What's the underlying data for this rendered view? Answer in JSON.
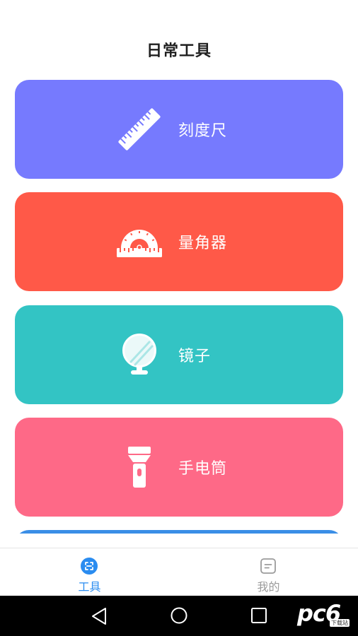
{
  "header": {
    "title": "日常工具"
  },
  "tools": [
    {
      "label": "刻度尺",
      "color": "#767AFE",
      "icon": "ruler-icon"
    },
    {
      "label": "量角器",
      "color": "#FF5948",
      "icon": "protractor-icon"
    },
    {
      "label": "镜子",
      "color": "#33C4C4",
      "icon": "mirror-icon"
    },
    {
      "label": "手电筒",
      "color": "#FE6987",
      "icon": "flashlight-icon"
    },
    {
      "color": "#3A8EE6"
    }
  ],
  "tabbar": {
    "active_color": "#2A8CF0",
    "inactive_color": "#9B9B9B",
    "items": [
      {
        "label": "工具",
        "icon": "tools-icon",
        "active": true
      },
      {
        "label": "我的",
        "icon": "profile-icon",
        "active": false
      }
    ]
  },
  "system_nav": {
    "background": "#000000",
    "buttons": [
      {
        "icon": "back-icon"
      },
      {
        "icon": "home-icon"
      },
      {
        "icon": "recents-icon"
      }
    ]
  },
  "watermark": {
    "text": "pc6",
    "tag": "下载站"
  }
}
